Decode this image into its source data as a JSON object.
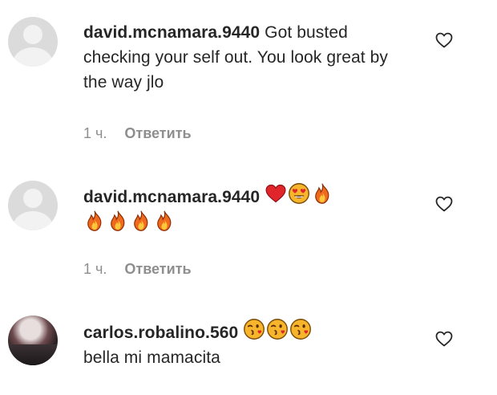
{
  "comments": [
    {
      "username": "david.mcnamara.9440",
      "text": "Got busted checking your self out. You look great by the way jlo",
      "time": "1 ч.",
      "reply_label": "Ответить",
      "avatar": "default-avatar",
      "like_icon": "heart-outline-icon"
    },
    {
      "username": "david.mcnamara.9440",
      "text": "",
      "emojis": [
        "red-heart-emoji",
        "heart-eyes-emoji",
        "fire-emoji",
        "fire-emoji",
        "fire-emoji",
        "fire-emoji",
        "fire-emoji"
      ],
      "time": "1 ч.",
      "reply_label": "Ответить",
      "avatar": "default-avatar",
      "like_icon": "heart-outline-icon"
    },
    {
      "username": "carlos.robalino.560",
      "text": "bella mi mamacita",
      "emojis": [
        "kissing-wink-emoji",
        "kissing-wink-emoji",
        "kissing-wink-emoji"
      ],
      "avatar": "photo-avatar",
      "like_icon": "heart-outline-icon"
    }
  ],
  "colors": {
    "text": "#262626",
    "meta": "#8e8e8e",
    "avatar_placeholder": "#dbdbdb",
    "heart_red": "#e0252b",
    "emoji_yellow": "#f7b52c",
    "fire_orange": "#f06a1d"
  }
}
